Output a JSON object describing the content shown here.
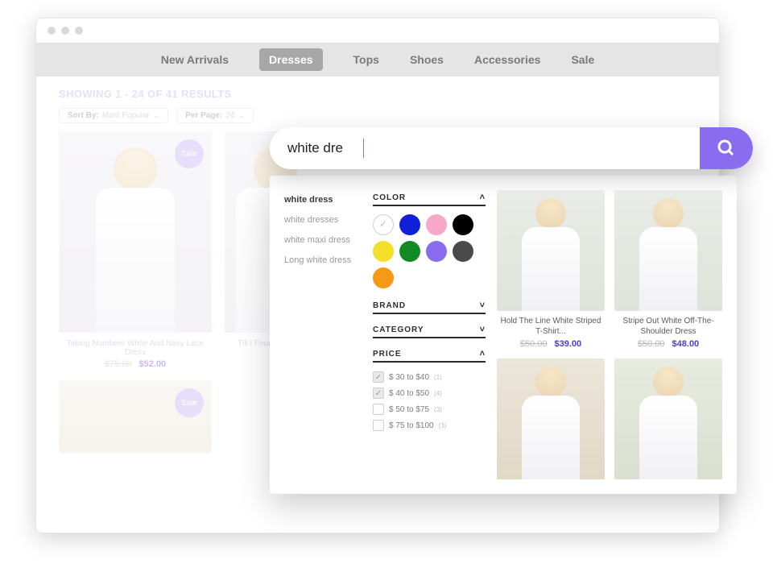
{
  "nav": {
    "items": [
      "New Arrivals",
      "Dresses",
      "Tops",
      "Shoes",
      "Accessories",
      "Sale"
    ],
    "active_index": 1
  },
  "listing": {
    "results_text": "SHOWING 1 - 24 OF 41 RESULTS",
    "sort": {
      "label": "Sort By:",
      "value": "Most Popular"
    },
    "per_page": {
      "label": "Per Page:",
      "value": "24"
    },
    "cards": [
      {
        "title": "Taking Numbers White And Navy Lace Dress",
        "old": "$75.00",
        "new": "$52.00",
        "badge": "Sale"
      },
      {
        "title": "Till I Found...",
        "old": "",
        "new": "",
        "badge": ""
      }
    ],
    "row2_badge": "Sale"
  },
  "search": {
    "query": "white dre",
    "suggestions": [
      "white dress",
      "white dresses",
      "white maxi dress",
      "Long white dress"
    ],
    "facets": {
      "color": {
        "label": "COLOR",
        "open": true,
        "swatches": [
          {
            "name": "white",
            "hex": "#ffffff",
            "selected": true
          },
          {
            "name": "blue",
            "hex": "#1020d8"
          },
          {
            "name": "pink",
            "hex": "#f7a7c8"
          },
          {
            "name": "black",
            "hex": "#000000"
          },
          {
            "name": "yellow",
            "hex": "#f6df2a"
          },
          {
            "name": "green",
            "hex": "#128a26"
          },
          {
            "name": "purple",
            "hex": "#8a6cf0"
          },
          {
            "name": "charcoal",
            "hex": "#4a4a4a"
          },
          {
            "name": "orange",
            "hex": "#f49a17"
          }
        ]
      },
      "brand": {
        "label": "BRAND",
        "open": false
      },
      "category": {
        "label": "CATEGORY",
        "open": false
      },
      "price": {
        "label": "PRICE",
        "open": true,
        "ranges": [
          {
            "label": "$ 30 to $40",
            "count": "(1)",
            "checked": true
          },
          {
            "label": "$ 40 to $50",
            "count": "(4)",
            "checked": true
          },
          {
            "label": "$ 50 to $75",
            "count": "(3)",
            "checked": false
          },
          {
            "label": "$ 75 to $100",
            "count": "(3)",
            "checked": false
          }
        ]
      }
    },
    "results": [
      {
        "title": "Hold The Line White Striped T-Shirt...",
        "old": "$50.00",
        "new": "$39.00"
      },
      {
        "title": "Stripe Out White Off-The-Shoulder Dress",
        "old": "$50.00",
        "new": "$48.00"
      },
      {
        "title": "",
        "old": "",
        "new": ""
      },
      {
        "title": "",
        "old": "",
        "new": ""
      }
    ]
  }
}
